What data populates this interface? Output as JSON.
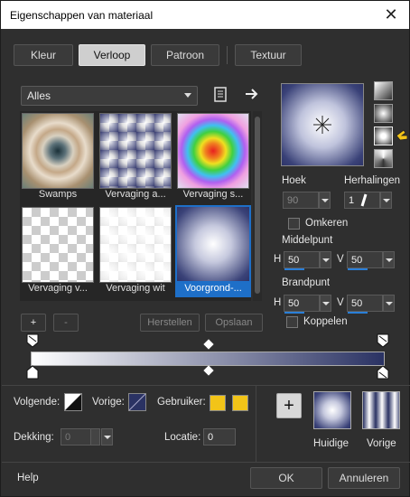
{
  "window": {
    "title": "Eigenschappen van materiaal",
    "close": "✕"
  },
  "tabs": [
    "Kleur",
    "Verloop",
    "Patroon",
    "Textuur"
  ],
  "category": "Alles",
  "gallery": [
    {
      "name": "Swamps"
    },
    {
      "name": "Vervaging a..."
    },
    {
      "name": "Vervaging s..."
    },
    {
      "name": "Vervaging v..."
    },
    {
      "name": "Vervaging wit"
    },
    {
      "name": "Voorgrond-..."
    }
  ],
  "gallery_buttons": {
    "add": "+",
    "remove": "-",
    "reset": "Herstellen",
    "save": "Opslaan"
  },
  "fields": {
    "angle_label": "Hoek",
    "angle_value": "90",
    "repeats_label": "Herhalingen",
    "repeats_value": "1",
    "invert_label": "Omkeren",
    "center_label": "Middelpunt",
    "center_h": "50",
    "center_v": "50",
    "focal_label": "Brandpunt",
    "focal_h": "50",
    "focal_v": "50",
    "link_label": "Koppelen",
    "h": "H",
    "v": "V"
  },
  "bottom": {
    "next_label": "Volgende:",
    "prev_label": "Vorige:",
    "user_label": "Gebruiker:",
    "opacity_label": "Dekking:",
    "opacity_value": "0",
    "location_label": "Locatie:",
    "location_value": "0",
    "current_label": "Huidige",
    "previous_label": "Vorige",
    "add": "+"
  },
  "footer": {
    "help": "Help",
    "ok": "OK",
    "cancel": "Annuleren"
  },
  "colors": {
    "user1": "#f2c418",
    "user2": "#f2c418",
    "accent": "#1e6fc8"
  }
}
